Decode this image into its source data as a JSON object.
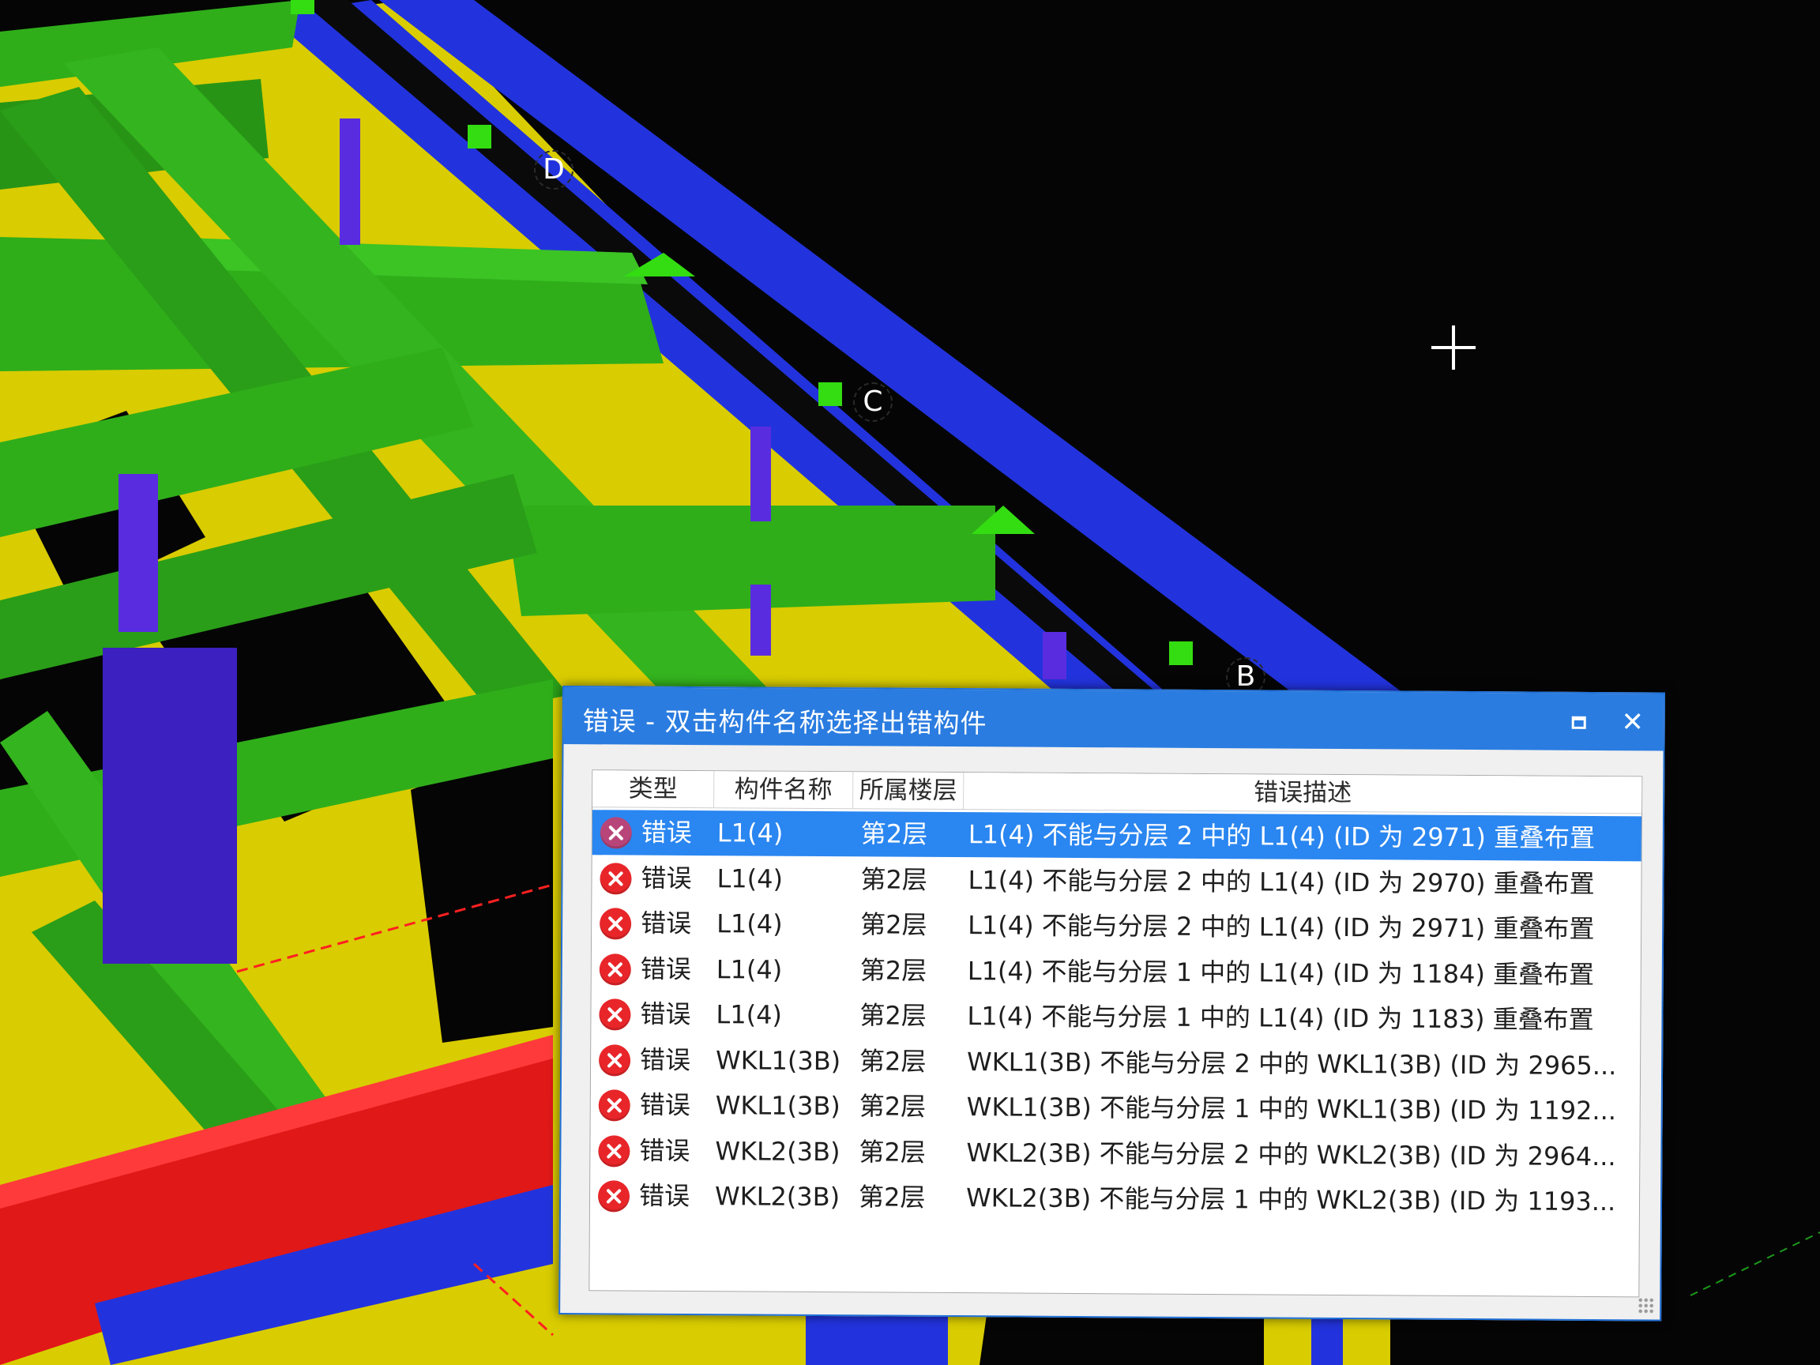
{
  "dialog": {
    "title": "错误 - 双击构件名称选择出错构件",
    "maximize_glyph": "□",
    "close_glyph": "✕"
  },
  "table": {
    "columns": [
      "类型",
      "构件名称",
      "所属楼层",
      "错误描述"
    ],
    "rows": [
      {
        "type": "错误",
        "name": "L1(4)",
        "floor": "第2层",
        "desc": "L1(4) 不能与分层 2 中的 L1(4) (ID 为 2971) 重叠布置"
      },
      {
        "type": "错误",
        "name": "L1(4)",
        "floor": "第2层",
        "desc": "L1(4) 不能与分层 2 中的 L1(4) (ID 为 2970) 重叠布置"
      },
      {
        "type": "错误",
        "name": "L1(4)",
        "floor": "第2层",
        "desc": "L1(4) 不能与分层 2 中的 L1(4) (ID 为 2971) 重叠布置"
      },
      {
        "type": "错误",
        "name": "L1(4)",
        "floor": "第2层",
        "desc": "L1(4) 不能与分层 1 中的 L1(4) (ID 为 1184) 重叠布置"
      },
      {
        "type": "错误",
        "name": "L1(4)",
        "floor": "第2层",
        "desc": "L1(4) 不能与分层 1 中的 L1(4) (ID 为 1183) 重叠布置"
      },
      {
        "type": "错误",
        "name": "WKL1(3B)",
        "floor": "第2层",
        "desc": "WKL1(3B) 不能与分层 2 中的 WKL1(3B) (ID 为 2965..."
      },
      {
        "type": "错误",
        "name": "WKL1(3B)",
        "floor": "第2层",
        "desc": "WKL1(3B) 不能与分层 1 中的 WKL1(3B) (ID 为 1192..."
      },
      {
        "type": "错误",
        "name": "WKL2(3B)",
        "floor": "第2层",
        "desc": "WKL2(3B) 不能与分层 2 中的 WKL2(3B) (ID 为 2964..."
      },
      {
        "type": "错误",
        "name": "WKL2(3B)",
        "floor": "第2层",
        "desc": "WKL2(3B) 不能与分层 1 中的 WKL2(3B) (ID 为 1193..."
      }
    ],
    "selected_index": 0
  },
  "viewport": {
    "axis_labels": [
      "D",
      "C",
      "B"
    ],
    "colors": {
      "background": "#050505",
      "slab": "#d9cc00",
      "beam_green": "#2fae1a",
      "beam_blue": "#2233dd",
      "column_purple": "#5a2ce0",
      "beam_red": "#e01818",
      "selection_blue": "#2a86f0",
      "title_blue": "#2a7ce0"
    }
  }
}
